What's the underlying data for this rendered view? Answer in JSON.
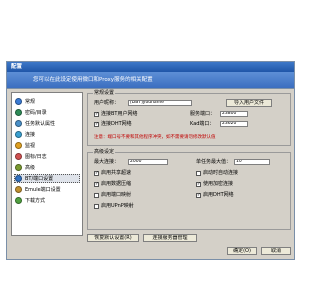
{
  "window": {
    "title": "配置",
    "banner": "您可以在此设定使用微口和Proxy服务的相关配置"
  },
  "colors": {
    "titlebar": "#1f56a8",
    "banner": "#3b6ec0",
    "note": "#c00000"
  },
  "sidebar": {
    "items": [
      {
        "label": "常规",
        "icon": "general-icon",
        "color": "#3a7bd5",
        "selected": false
      },
      {
        "label": "密码/目录",
        "icon": "password-icon",
        "color": "#2e8b57",
        "selected": false
      },
      {
        "label": "任务默认属性",
        "icon": "task-icon",
        "color": "#4a90c8",
        "selected": false
      },
      {
        "label": "连接",
        "icon": "connection-icon",
        "color": "#3aa0d0",
        "selected": false
      },
      {
        "label": "监视",
        "icon": "monitor-icon",
        "color": "#e0a020",
        "selected": false
      },
      {
        "label": "图标/日志",
        "icon": "log-icon",
        "color": "#d05050",
        "selected": false
      },
      {
        "label": "高级",
        "icon": "advanced-icon",
        "color": "#7a9a30",
        "selected": false
      },
      {
        "label": "BT/端口设置",
        "icon": "bt-icon",
        "color": "#3070c0",
        "selected": true
      },
      {
        "label": "Emule端口设置",
        "icon": "emule-icon",
        "color": "#c09030",
        "selected": false
      },
      {
        "label": "下载方式",
        "icon": "download-icon",
        "color": "#50a040",
        "selected": false
      }
    ]
  },
  "basic": {
    "title": "常规设置",
    "user_label": "用户昵称：",
    "user_value": "[DBT]youname",
    "import_button": "导入用户文件",
    "chk_upnp_label": "连接BT用户网络",
    "chk_upnp": true,
    "port_label": "服务端口：",
    "port_value": "23800",
    "chk_dht_label": "连接DHT网络",
    "chk_dht": true,
    "kad_label": "Kad端口：",
    "kad_value": "23620",
    "note": "注意：端口号不要和其他程序冲突，如不需要请勿修改默认值"
  },
  "advanced": {
    "title": "高级设定",
    "max_conn_label": "最大连接：",
    "max_conn_value": "2000",
    "max_single_label": "单任务最大值：",
    "max_single_value": "10",
    "checks": [
      {
        "label": "启用共享超速",
        "checked": true
      },
      {
        "label": "启动时自动连接",
        "checked": false
      },
      {
        "label": "启用数据压缩",
        "checked": true
      },
      {
        "label": "使用加密连接",
        "checked": true
      },
      {
        "label": "启用端口映射",
        "checked": false
      },
      {
        "label": "启用DHT网络",
        "checked": true
      },
      {
        "label": "启用UPnP映射",
        "checked": false
      }
    ]
  },
  "buttons": {
    "restore_defaults": "恢复默认设置(R)",
    "connect_server": "连接服务器管理",
    "ok": "确定(O)",
    "cancel": "取消"
  }
}
